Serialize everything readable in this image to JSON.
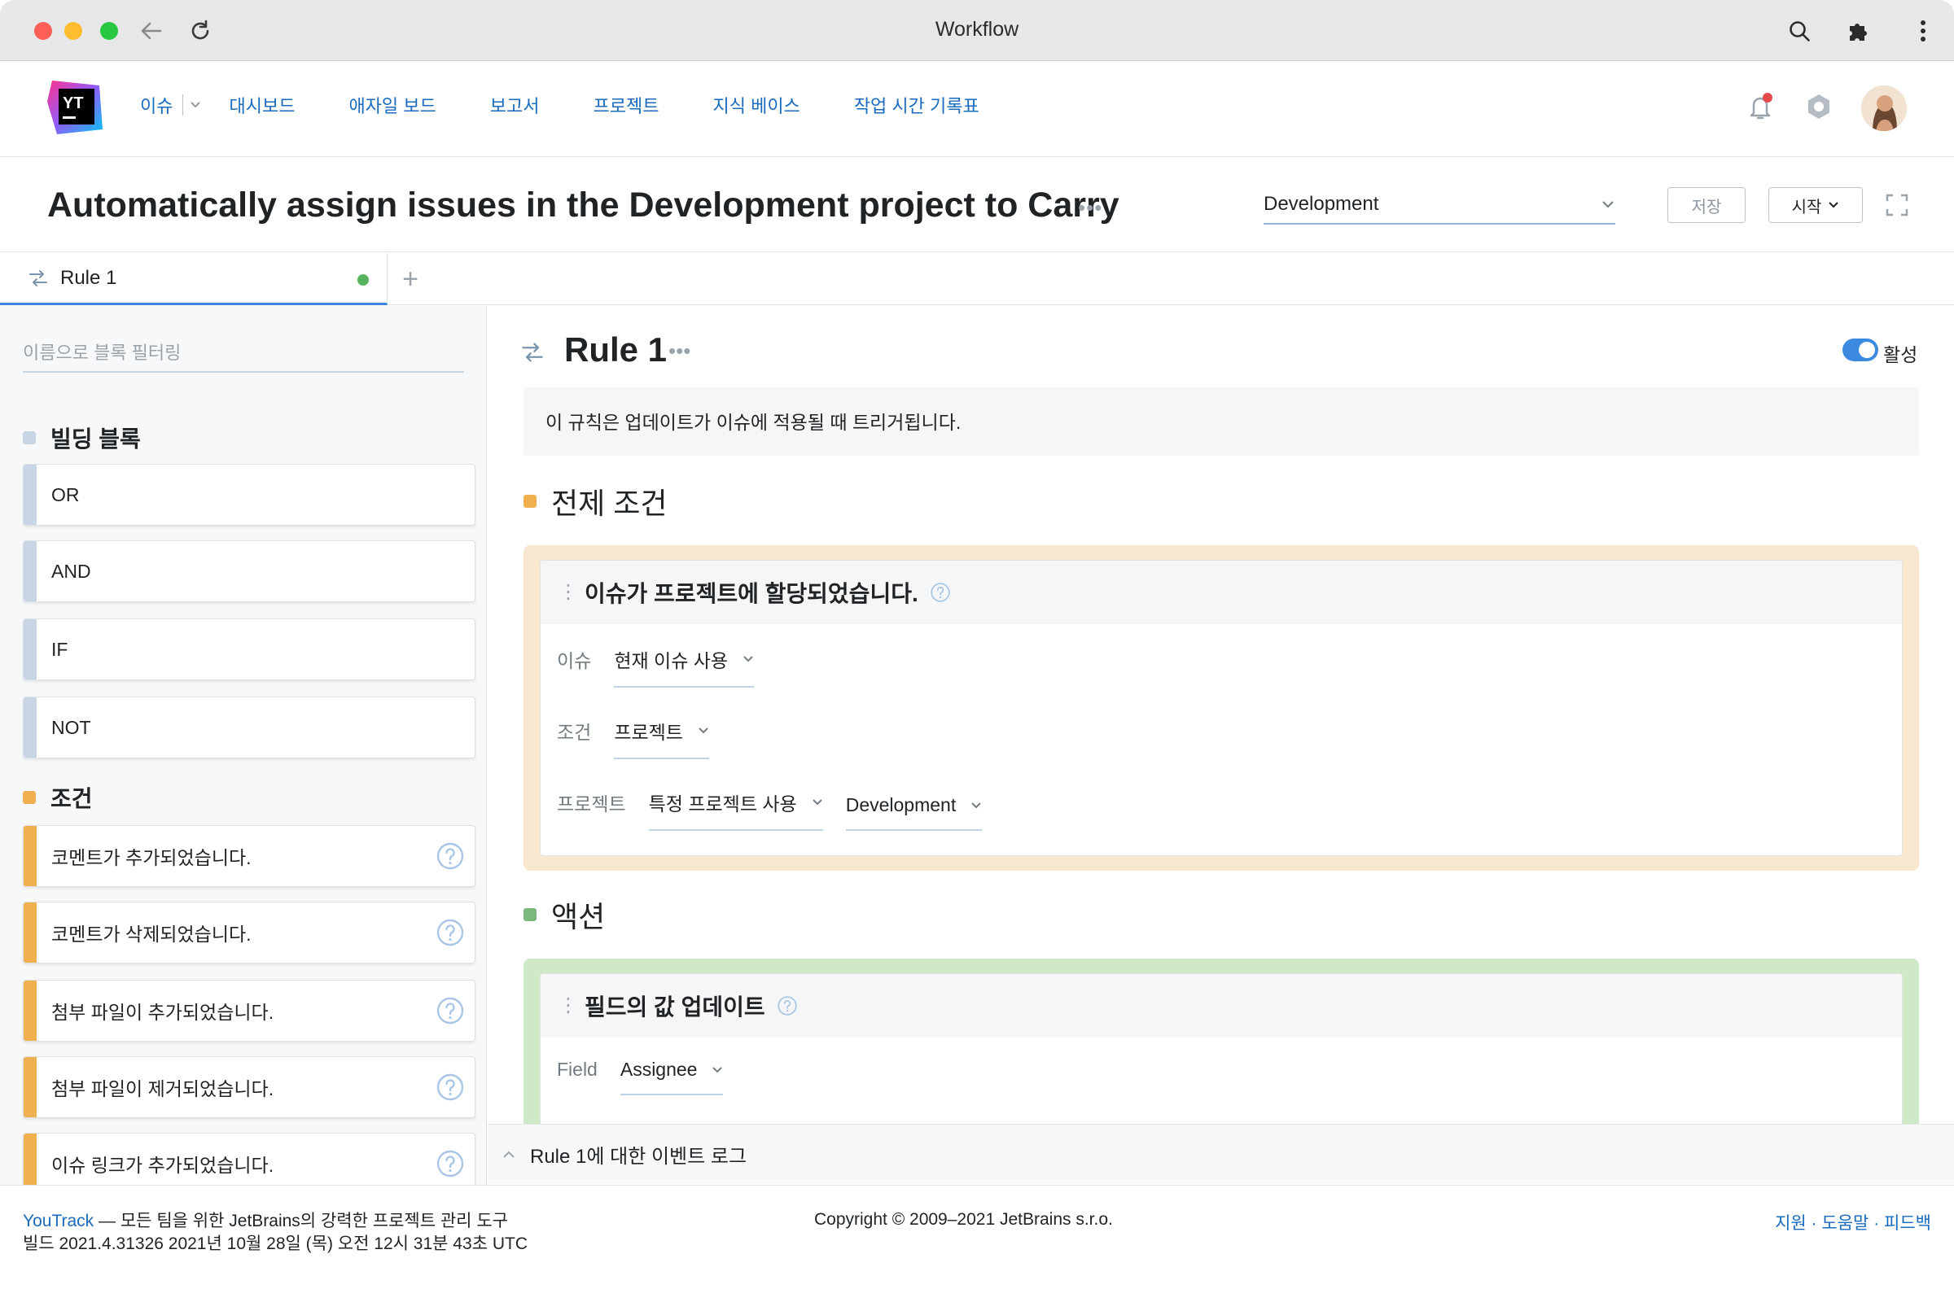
{
  "window": {
    "title": "Workflow"
  },
  "nav": {
    "items": [
      "이슈",
      "대시보드",
      "애자일 보드",
      "보고서",
      "프로젝트",
      "지식 베이스",
      "작업 시간 기록표"
    ]
  },
  "header": {
    "title": "Automatically assign issues in the Development project to Carry",
    "project_select": "Development",
    "save_label": "저장",
    "start_label": "시작"
  },
  "tabs": [
    {
      "label": "Rule 1"
    }
  ],
  "sidebar": {
    "filter_placeholder": "이름으로 블록 필터링",
    "building_blocks_title": "빌딩 블록",
    "building_blocks": [
      "OR",
      "AND",
      "IF",
      "NOT"
    ],
    "conditions_title": "조건",
    "conditions": [
      "코멘트가 추가되었습니다.",
      "코멘트가 삭제되었습니다.",
      "첨부 파일이 추가되었습니다.",
      "첨부 파일이 제거되었습니다.",
      "이슈 링크가 추가되었습니다."
    ]
  },
  "rule": {
    "title": "Rule 1",
    "active_label": "활성",
    "active": true,
    "description": "이 규칙은 업데이트가 이슈에 적용될 때 트리거됩니다.",
    "precondition_title": "전제 조건",
    "precondition_card": {
      "title": "이슈가 프로젝트에 할당되었습니다.",
      "issue_label": "이슈",
      "issue_value": "현재 이슈 사용",
      "condition_label": "조건",
      "condition_value": "프로젝트",
      "project_label": "프로젝트",
      "project_mode": "특정 프로젝트 사용",
      "project_value": "Development"
    },
    "action_title": "액션",
    "action_card": {
      "title": "필드의 값 업데이트",
      "field_label": "Field",
      "field_value": "Assignee"
    }
  },
  "event_log": {
    "label": "Rule 1에 대한 이벤트 로그"
  },
  "footer": {
    "brand": "YouTrack",
    "tagline": " — 모든 팀을 위한 JetBrains의 강력한 프로젝트 관리 도구",
    "build": "빌드 2021.4.31326 2021년 10월 28일 (목) 오전 12시 31분 43초 UTC",
    "copyright": "Copyright © 2009–2021 JetBrains s.r.o.",
    "support": "지원",
    "help": "도움말",
    "feedback": "피드백",
    "separator": " · "
  },
  "colors": {
    "accent": "#1a6bbf",
    "precondition": "#f0b050",
    "action": "#7cb87c",
    "building_block": "#c7d5e4",
    "condition_bar": "#f0b050"
  },
  "icons": [
    "back-arrow-icon",
    "reload-icon",
    "search-icon",
    "puzzle-icon",
    "kebab-icon",
    "bell-icon",
    "help-hexagon-icon",
    "rule-arrows-icon",
    "help-circle-icon",
    "chevron-down-icon",
    "chevron-up-icon",
    "fullscreen-icon"
  ]
}
